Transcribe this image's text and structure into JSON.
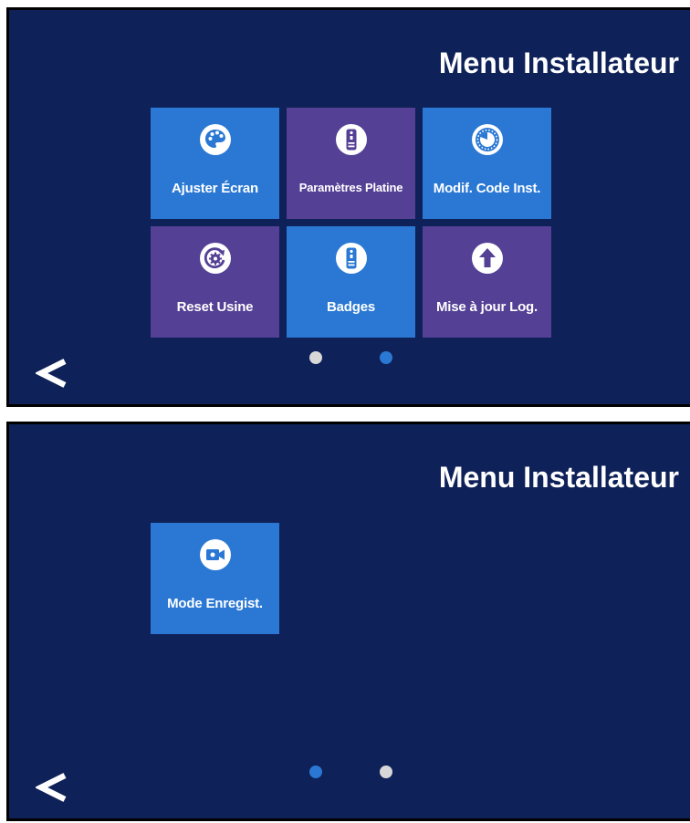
{
  "colors": {
    "background": "#0e2158",
    "tile_blue": "#2a78d4",
    "tile_purple": "#544095",
    "dot_active": "#2a78d4",
    "dot_inactive": "#d8d8d8"
  },
  "screens": [
    {
      "title": "Menu Installateur",
      "tiles": [
        {
          "label": "Ajuster Écran",
          "icon": "palette-icon",
          "color": "blue"
        },
        {
          "label": "Paramètres Platine",
          "icon": "door-station-icon",
          "color": "purple"
        },
        {
          "label": "Modif. Code Inst.",
          "icon": "dial-icon",
          "color": "blue"
        },
        {
          "label": "Reset Usine",
          "icon": "factory-reset-icon",
          "color": "purple"
        },
        {
          "label": "Badges",
          "icon": "door-station-icon",
          "color": "blue"
        },
        {
          "label": "Mise à jour Log.",
          "icon": "upload-arrow-icon",
          "color": "purple"
        }
      ],
      "back_label": "<",
      "pagination": {
        "pages": 2,
        "active": 2
      }
    },
    {
      "title": "Menu Installateur",
      "tiles": [
        {
          "label": "Mode Enregist.",
          "icon": "video-camera-icon",
          "color": "blue"
        }
      ],
      "back_label": "<",
      "pagination": {
        "pages": 2,
        "active": 1
      }
    }
  ]
}
